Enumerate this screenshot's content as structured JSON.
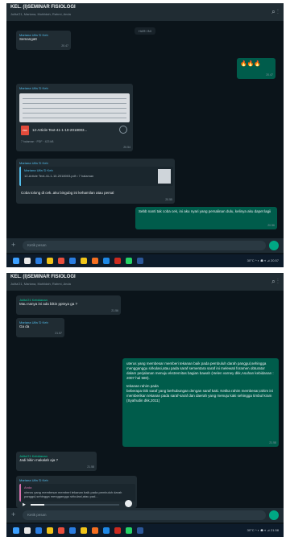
{
  "screens": [
    {
      "header": {
        "title": "KEL. (I)SEMINAR FISIOLOGI",
        "subtitle": "Julita'21, Mariana, Muhlidah, Rahmi, Anda"
      },
      "system_badge": "HARI INI",
      "messages": {
        "m1": {
          "sender": "Mariana Ulfa 'D Keb",
          "text": "Semangatt",
          "time": "20.47"
        },
        "m2": {
          "text": "🔥🔥🔥",
          "time": "20.47"
        },
        "m3": {
          "sender": "Mariana Ulfa 'D Keb",
          "file_name": "12-Article Text-41-1-10-2018003...",
          "file_meta": "7 halaman · PDF · 423 kB",
          "time": "20.54"
        },
        "m4": {
          "sender": "Mariana Ulfa 'D Keb",
          "quote_sender": "Mariana Ulfa 'D Keb",
          "quote_text": "12-Article Text-41-1-10-2018003.pdf • 7 halaman",
          "text": "Coba tolong di cek..aku bingubg ini kehamilan atau persal",
          "time": "20.55"
        },
        "m5": {
          "text": "Sebb nanti tak coba cek, ini aku nyari yang persalinan dulu, kelinya aku dapet lagii",
          "time": "20.56"
        }
      },
      "footer": {
        "placeholder": "Ketik pesan"
      },
      "tray": "30°C  ^ ◐ ☗ ⋄ ⊿ 20.57"
    },
    {
      "header": {
        "title": "KEL. (I)SEMINAR FISIOLOGI",
        "subtitle": "Julita'21, Mariana, Muhlidah, Rahmi, Anda"
      },
      "messages": {
        "m1": {
          "sender": "Julita'21 Kebidanan",
          "text": "Mau nanya ini ada bikin pptnya ga ?",
          "time": "21.56"
        },
        "m2": {
          "sender": "Mariana Ulfa 'D Keb",
          "text": "Ga da",
          "time": "21.57"
        },
        "m3": {
          "text": "uterus yang membesar memberi tekanan baik pada pembuluh darah panggul,sehingga mengganggu sirkulasi,atau pada saraf sementara saraf ini melewati foramen obturator dalam perjalanan menuju ekstremitas bagian bawah (Helen varney dkk,Asuhan kebidanan : 2007 hal 580).",
          "text2": "tekanan rahim pada",
          "text3": "beberapa titik saraf yang berhubungan dengan saraf kaki. Ketika rahim membesar,rahim ini memberikan tekanan pada saraf-saraf dan daerah yang menuju kaki sehingga timbul kram (Syafrudin dkk,2011)",
          "time": "21.58"
        },
        "m4": {
          "sender": "Julita'21 Kebidanan",
          "text": "Jadi bikin makalah aja ?",
          "time": "21.58"
        },
        "m5": {
          "sender": "Mariana Ulfa 'D Keb",
          "quote_sender": "Anda",
          "quote_text": "uterus yang membesar memberi tekanan baik pada pembuluh darah panggul,sehingga mengganggu sirkulasi,atau pad...",
          "media_progress": 0.15
        }
      },
      "footer": {
        "placeholder": "Ketik pesan"
      },
      "tray": "30°C  ^ ◐ ☗ ⋄ ⊿ 21.58"
    }
  ],
  "colors": {
    "chat_bg": "#0b141a",
    "incoming": "#202c33",
    "outgoing": "#005c4b",
    "accent": "#00a884"
  },
  "icons": [
    "search-icon",
    "more-icon",
    "plus-icon",
    "mic-icon",
    "pdf-file-icon",
    "download-icon",
    "play-icon",
    "taskbar-app-icons"
  ]
}
